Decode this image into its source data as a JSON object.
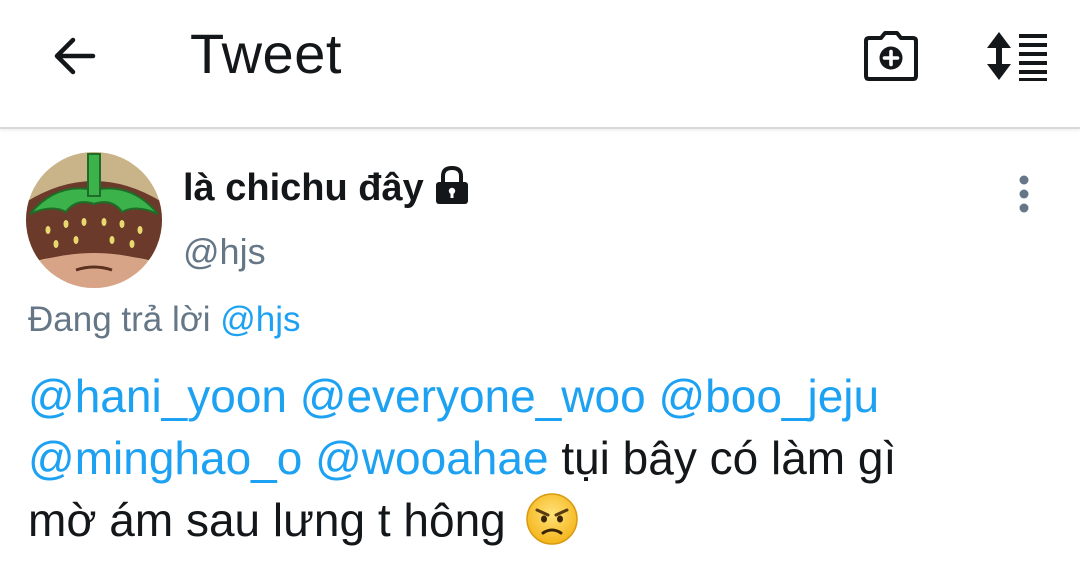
{
  "appbar": {
    "title": "Tweet",
    "back_icon": "arrow-left-icon",
    "camera_icon": "camera-plus-icon",
    "sort_icon": "sort-order-icon"
  },
  "tweet": {
    "display_name": "là chichu đây",
    "lock_icon": "lock-icon",
    "handle": "@hjs",
    "more_icon": "more-vertical-icon",
    "reply_prefix": "Đang trả lời",
    "reply_to": "@hjs",
    "lines": [
      {
        "mentions": [
          "@hani_yoon",
          "@everyone_woo",
          "@boo_jeju"
        ],
        "text": ""
      },
      {
        "mentions": [
          "@minghao_o",
          "@wooahae"
        ],
        "text": "tụi bây có làm gì"
      },
      {
        "mentions": [],
        "text": "mờ ám sau lưng t hông"
      }
    ],
    "emoji": "angry-face-emoji"
  },
  "colors": {
    "mention": "#1da1f2",
    "secondary_text": "#657786",
    "primary_text": "#14171a",
    "divider": "#d8d8d8"
  }
}
